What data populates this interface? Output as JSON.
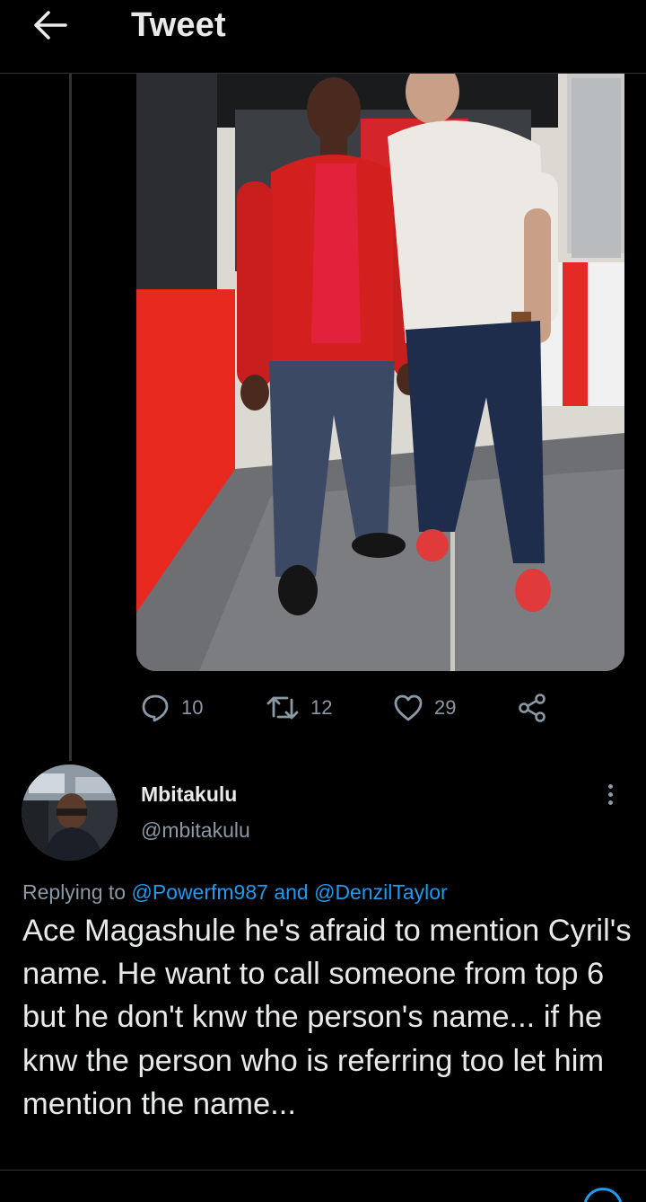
{
  "header": {
    "title": "Tweet",
    "back_icon": "arrow-left-icon"
  },
  "media": {
    "description_icon": "photo"
  },
  "engagement": {
    "replies": "10",
    "retweets": "12",
    "likes": "29",
    "icons": [
      "reply-icon",
      "retweet-icon",
      "like-icon",
      "share-icon"
    ]
  },
  "reply": {
    "display_name": "Mbitakulu",
    "handle": "@mbitakulu",
    "replying_prefix": "Replying to",
    "mention_1": "@Powerfm987",
    "conjunction": "and",
    "mention_2": "@DenzilTaylor",
    "text": "Ace Magashule he's afraid to mention Cyril's name. He want to call someone from top 6 but he don't knw the person's name... if he knw the person who is referring too let him mention the name..."
  },
  "colors": {
    "background": "#000000",
    "text": "#e7e9ea",
    "secondary": "#8b98a5",
    "link": "#1d9bf0",
    "divider": "#2f3336"
  }
}
